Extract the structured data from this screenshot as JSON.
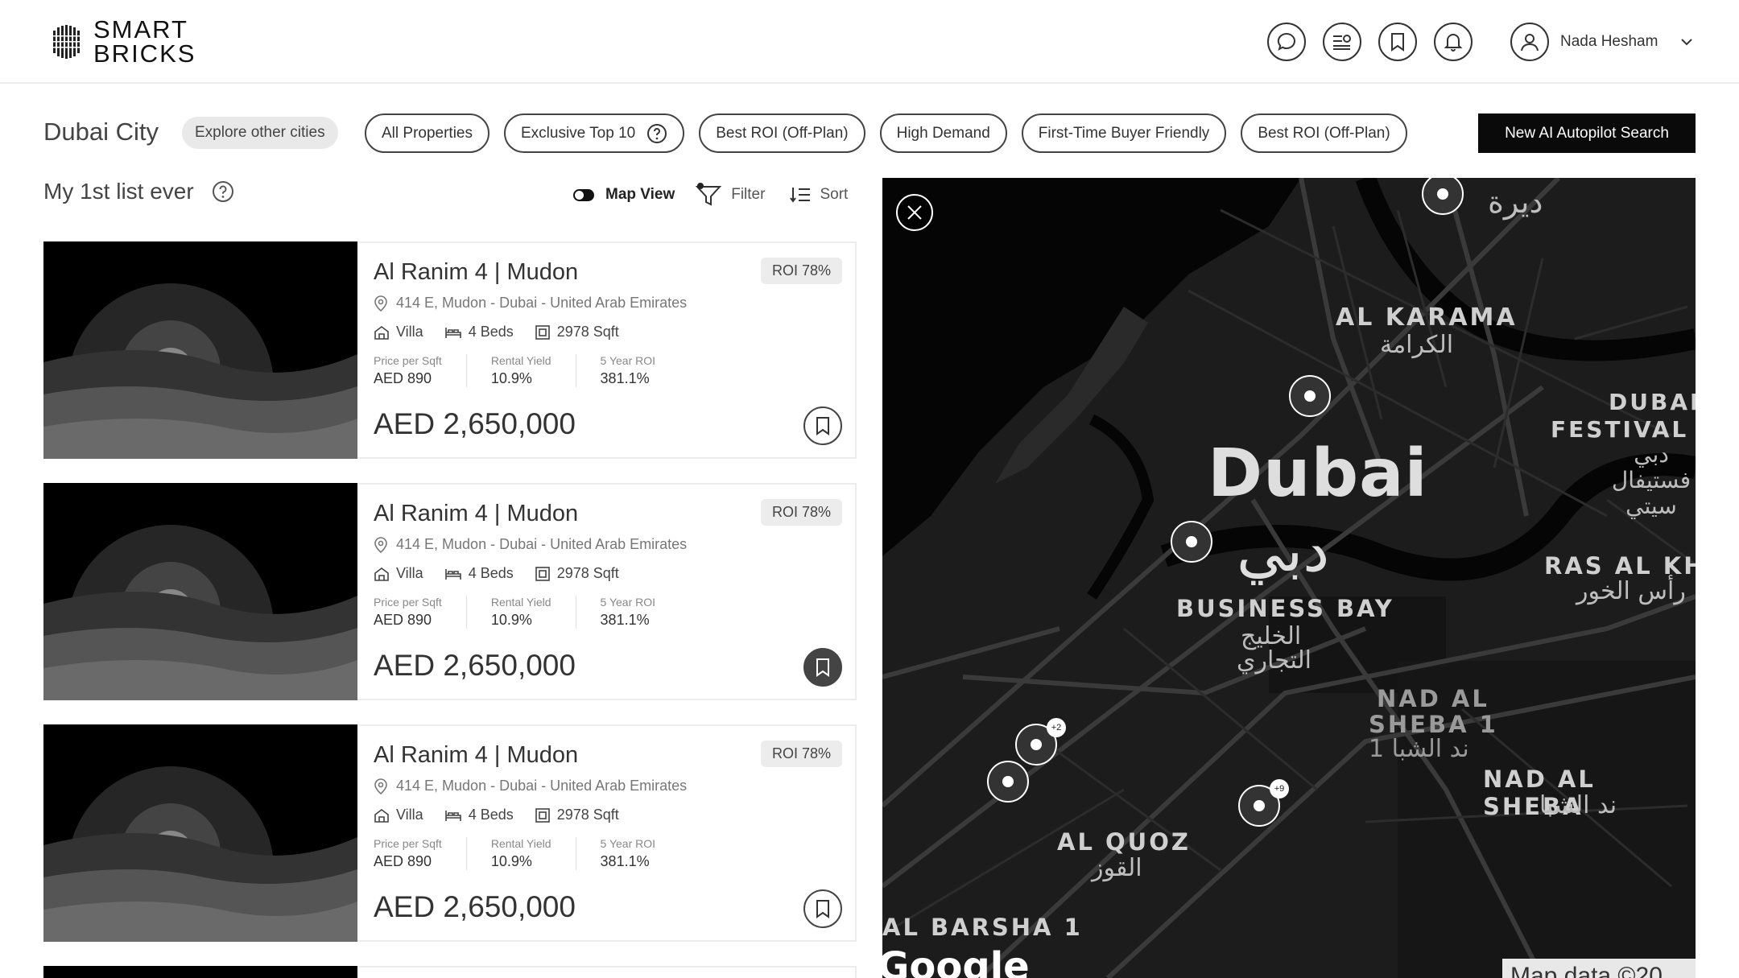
{
  "brand": {
    "line1": "SMART",
    "line2": "BRICKS"
  },
  "header": {
    "icons": [
      "chat-icon",
      "list-view-icon",
      "bookmark-icon",
      "notification-bell-icon"
    ],
    "user_name": "Nada Hesham"
  },
  "filters": {
    "city": "Dubai City",
    "explore_label": "Explore other cities",
    "chips": [
      "All Properties",
      "Exclusive Top 10",
      "Best ROI (Off-Plan)",
      "High Demand",
      "First-Time Buyer Friendly",
      "Best ROI (Off-Plan)"
    ],
    "cta": "New AI Autopilot Search"
  },
  "list": {
    "title": "My 1st list ever",
    "map_view_label": "Map View",
    "map_view_on": true,
    "filter_label": "Filter",
    "sort_label": "Sort"
  },
  "cards": [
    {
      "title": "Al Ranim 4 | Mudon",
      "roi": "ROI 78%",
      "address": "414 E, Mudon - Dubai - United Arab Emirates",
      "type": "Villa",
      "beds": "4 Beds",
      "area": "2978 Sqft",
      "stats": [
        {
          "label": "Price per Sqft",
          "value": "AED 890"
        },
        {
          "label": "Rental Yield",
          "value": "10.9%"
        },
        {
          "label": "5 Year ROI",
          "value": "381.1%"
        }
      ],
      "price": "AED 2,650,000",
      "saved": false
    },
    {
      "title": "Al Ranim 4 | Mudon",
      "roi": "ROI 78%",
      "address": "414 E, Mudon - Dubai - United Arab Emirates",
      "type": "Villa",
      "beds": "4 Beds",
      "area": "2978 Sqft",
      "stats": [
        {
          "label": "Price per Sqft",
          "value": "AED 890"
        },
        {
          "label": "Rental Yield",
          "value": "10.9%"
        },
        {
          "label": "5 Year ROI",
          "value": "381.1%"
        }
      ],
      "price": "AED 2,650,000",
      "saved": true
    },
    {
      "title": "Al Ranim 4 | Mudon",
      "roi": "ROI 78%",
      "address": "414 E, Mudon - Dubai - United Arab Emirates",
      "type": "Villa",
      "beds": "4 Beds",
      "area": "2978 Sqft",
      "stats": [
        {
          "label": "Price per Sqft",
          "value": "AED 890"
        },
        {
          "label": "Rental Yield",
          "value": "10.9%"
        },
        {
          "label": "5 Year ROI",
          "value": "381.1%"
        }
      ],
      "price": "AED 2,650,000",
      "saved": false
    }
  ],
  "map": {
    "labels": {
      "deira": "ديرة",
      "karama_en": "AL KARAMA",
      "karama_ar": "الكرامة",
      "dubai_en": "Dubai",
      "dubai_ar": "دبي",
      "festival_en1": "DUBAI",
      "festival_en2": "FESTIVAL C",
      "festival_ar": "دبي فستيفال سيتي",
      "business_bay_en": "BUSINESS BAY",
      "business_bay_ar1": "الخليج",
      "business_bay_ar2": "التجاري",
      "ras_en": "RAS AL KH",
      "ras_ar": "رأس الخور",
      "nad_sheba1_en1": "NAD AL",
      "nad_sheba1_en2": "SHEBA 1",
      "nad_sheba1_ar": "ند الشبا 1",
      "nad_sheba_en": "NAD AL SHEBA",
      "nad_sheba_ar": "ند الشبا",
      "quoz_en": "AL QUOZ",
      "quoz_ar": "القوز",
      "barsha_en": "AL BARSHA 1",
      "google": "Google",
      "map_data": "Map data ©20"
    },
    "pin_badges": [
      "+2",
      "+9"
    ]
  }
}
